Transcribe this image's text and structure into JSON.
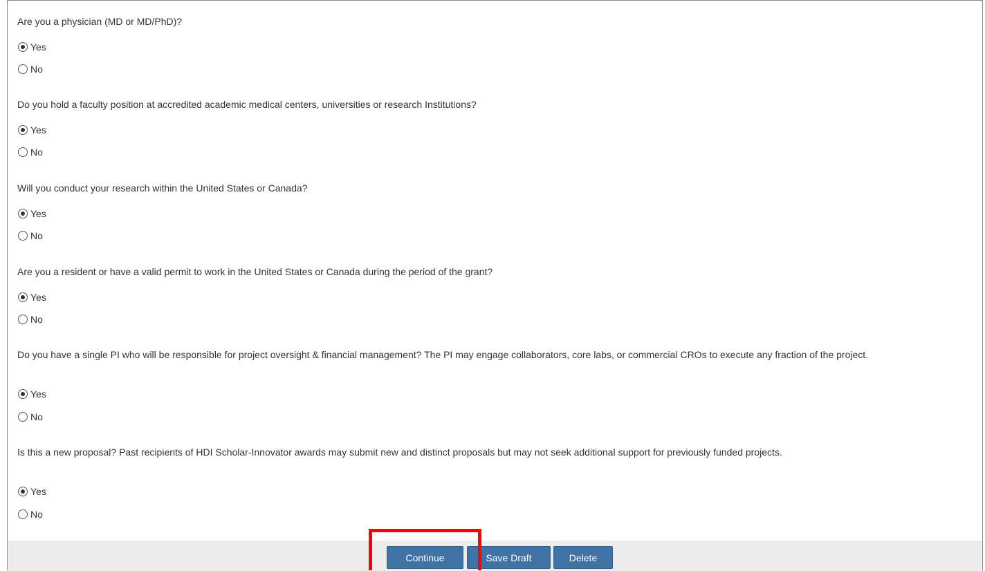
{
  "questions": [
    {
      "text": "Are you a physician (MD or MD/PhD)?",
      "options": [
        {
          "label": "Yes",
          "checked": true
        },
        {
          "label": "No",
          "checked": false
        }
      ]
    },
    {
      "text": "Do you hold a faculty position at accredited academic medical centers, universities or research Institutions?",
      "options": [
        {
          "label": "Yes",
          "checked": true
        },
        {
          "label": "No",
          "checked": false
        }
      ]
    },
    {
      "text": "Will you conduct your research within the United States or Canada?",
      "options": [
        {
          "label": "Yes",
          "checked": true
        },
        {
          "label": "No",
          "checked": false
        }
      ]
    },
    {
      "text": "Are you a resident or have a valid permit to work in the United States or Canada during the period of the grant?",
      "options": [
        {
          "label": "Yes",
          "checked": true
        },
        {
          "label": "No",
          "checked": false
        }
      ]
    },
    {
      "text": "Do you have a single PI who will be responsible for project oversight & financial management? The PI may engage collaborators, core labs, or commercial CROs to execute any fraction of the project.",
      "options": [
        {
          "label": "Yes",
          "checked": true
        },
        {
          "label": "No",
          "checked": false
        }
      ]
    },
    {
      "text": "Is this a new proposal? Past recipients of HDI Scholar-Innovator awards may submit new and distinct proposals but may not seek additional support for previously funded projects.",
      "options": [
        {
          "label": "Yes",
          "checked": true
        },
        {
          "label": "No",
          "checked": false
        }
      ]
    }
  ],
  "footer": {
    "continue_label": "Continue",
    "save_draft_label": "Save Draft",
    "delete_label": "Delete"
  },
  "colors": {
    "button_bg": "#3f73a8",
    "footer_bg": "#ececec",
    "highlight": "#ff0000"
  }
}
